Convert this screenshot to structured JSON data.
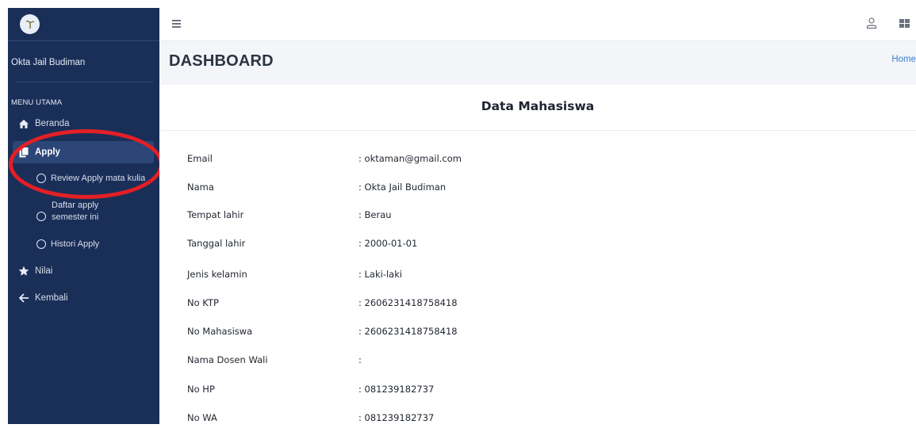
{
  "sidebar": {
    "brand_name": "",
    "user_name": "Okta Jail Budiman",
    "menu_header": "MENU UTAMA",
    "items": {
      "beranda": "Beranda",
      "apply": "Apply",
      "review_apply": "Review Apply mata kulia",
      "daftar_apply_line1": "Daftar apply",
      "daftar_apply_line2": "semester ini",
      "histori_apply": "Histori Apply",
      "nilai": "Nilai",
      "kembali": "Kembali"
    },
    "icons": {
      "beranda": "home-icon",
      "apply": "copy-icon",
      "nilai": "star-icon",
      "kembali": "arrow-left-icon"
    }
  },
  "topbar": {
    "icons": [
      "menu-icon",
      "user-icon",
      "grid-icon"
    ]
  },
  "header": {
    "title": "DASHBOARD",
    "breadcrumb": "Home"
  },
  "card": {
    "title": "Data Mahasiswa",
    "fields": [
      {
        "label": "Email",
        "value": ": oktaman@gmail.com"
      },
      {
        "label": "Nama",
        "value": ": Okta Jail Budiman"
      },
      {
        "label": "Tempat lahir",
        "value": ": Berau"
      },
      {
        "label": "Tanggal lahir",
        "value": ": 2000-01-01"
      },
      {
        "label": "Jenis kelamin",
        "value": ": Laki-laki"
      },
      {
        "label": "No KTP",
        "value": ": 2606231418758418"
      },
      {
        "label": "No Mahasiswa",
        "value": ": 2606231418758418"
      },
      {
        "label": "Nama Dosen Wali",
        "value": ":"
      },
      {
        "label": "No HP",
        "value": ": 081239182737"
      },
      {
        "label": "No WA",
        "value": ": 081239182737"
      }
    ]
  },
  "colors": {
    "sidebar_bg": "#1a2f58",
    "active_bg": "#2c4678",
    "highlight": "#e41f25",
    "link": "#3b82d6"
  }
}
